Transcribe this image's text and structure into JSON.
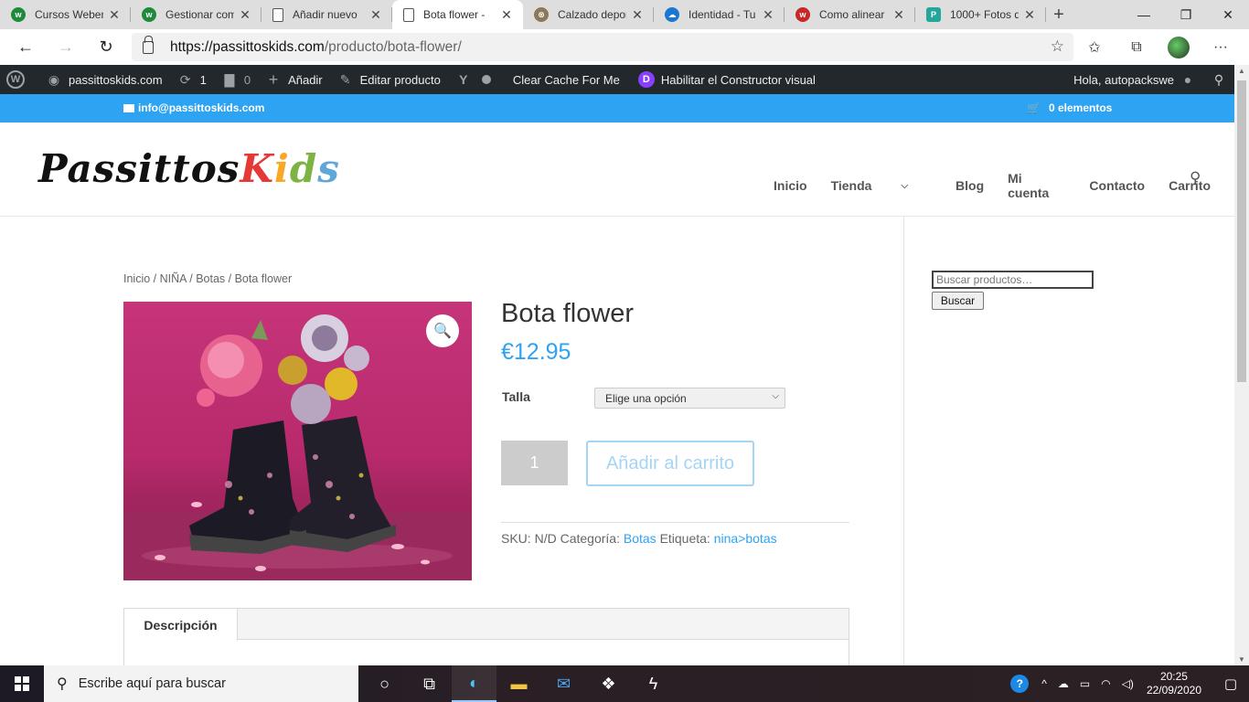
{
  "browser": {
    "tabs": [
      {
        "title": "Cursos Weben",
        "favicon_color": "#1f8a3b",
        "favicon_letter": "w"
      },
      {
        "title": "Gestionar com",
        "favicon_color": "#1f8a3b",
        "favicon_letter": "w"
      },
      {
        "title": "Añadir nuevo",
        "favicon_color": "",
        "favicon_letter": ""
      },
      {
        "title": "Bota flower -",
        "favicon_color": "",
        "favicon_letter": ""
      },
      {
        "title": "Calzado depor",
        "favicon_color": "#8a7a5a",
        "favicon_letter": "⊗"
      },
      {
        "title": "Identidad - Tu",
        "favicon_color": "#1976d2",
        "favicon_letter": "☁"
      },
      {
        "title": "Como alinear",
        "favicon_color": "#c62828",
        "favicon_letter": "w"
      },
      {
        "title": "1000+ Fotos d",
        "favicon_color": "#26a69a",
        "favicon_letter": "P"
      }
    ],
    "url_host": "https://passittoskids.com",
    "url_path": "/producto/bota-flower/"
  },
  "wpbar": {
    "site": "passittoskids.com",
    "updates": "1",
    "comments": "0",
    "add_new": "Añadir",
    "edit_product": "Editar producto",
    "clear_cache": "Clear Cache For Me",
    "visual_builder": "Habilitar el Constructor visual",
    "greeting": "Hola, autopackswe"
  },
  "topbar": {
    "email": "info@passittoskids.com",
    "cart_count": "0 elementos"
  },
  "logo": {
    "part1": "Passittos",
    "k": "K",
    "i": "i",
    "d": "d",
    "s": "s"
  },
  "nav": {
    "items": [
      "Inicio",
      "Tienda",
      "Blog",
      "Mi cuenta",
      "Contacto",
      "Carrito"
    ]
  },
  "breadcrumb": "Inicio / NIÑA / Botas / Bota flower",
  "product": {
    "title": "Bota flower",
    "price": "€12.95",
    "talla_label": "Talla",
    "talla_selected": "Elige una opción",
    "quantity": "1",
    "add_to_cart": "Añadir al carrito",
    "sku_label": "SKU:",
    "sku_value": "N/D",
    "category_label": "Categoría:",
    "category": "Botas",
    "tag_label": "Etiqueta:",
    "tag": "nina>botas",
    "tab_description": "Descripción"
  },
  "sidebar": {
    "search_placeholder": "Buscar productos…",
    "search_button": "Buscar"
  },
  "taskbar": {
    "search_placeholder": "Escribe aquí para buscar",
    "time": "20:25",
    "date": "22/09/2020"
  }
}
